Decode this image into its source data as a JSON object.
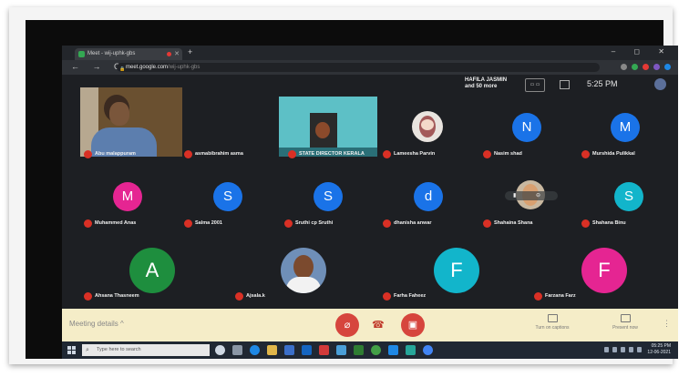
{
  "browser": {
    "tab_title": "Meet - wij-uphk-gbs",
    "new_tab": "+",
    "window_controls": "– ◻ ✕",
    "nav_buttons": "← → C",
    "url_host": "meet.google.com",
    "url_path": "/wij-uphk-gbs"
  },
  "meet_header": {
    "participants_line1": "HAFILA JASMIN",
    "participants_line2": "and 50 more",
    "time": "5:25 PM"
  },
  "tiles": [
    {
      "kind": "video",
      "name": "Abu malappuram"
    },
    {
      "kind": "dark",
      "name": "asmabibrahim asma"
    },
    {
      "kind": "video",
      "name": "STATE DIRECTOR KERALA"
    },
    {
      "kind": "photo",
      "name": "Lameesha Parvin"
    },
    {
      "kind": "letter",
      "letter": "N",
      "color": "#1a73e8",
      "name": "Nasim shad"
    },
    {
      "kind": "letter",
      "letter": "M",
      "color": "#1a73e8",
      "name": "Murshida Pulikkal"
    },
    {
      "kind": "letter",
      "letter": "M",
      "color": "#e52592",
      "name": "Muhammed Anas"
    },
    {
      "kind": "letter",
      "letter": "S",
      "color": "#1a73e8",
      "name": "Salma 2001"
    },
    {
      "kind": "letter",
      "letter": "S",
      "color": "#1a73e8",
      "name": "Sruthi cp Sruthi"
    },
    {
      "kind": "letter",
      "letter": "d",
      "color": "#1a73e8",
      "name": "dhanisha anwar"
    },
    {
      "kind": "photo",
      "name": "Shahaina Shana"
    },
    {
      "kind": "letter",
      "letter": "S",
      "color": "#12b5cb",
      "name": "Shahana Binu"
    },
    {
      "kind": "letter",
      "letter": "A",
      "color": "#1e8e3e",
      "name": "Ahsana Thasneem"
    },
    {
      "kind": "photo",
      "name": "Ajsala.k"
    },
    {
      "kind": "letter",
      "letter": "F",
      "color": "#12b5cb",
      "name": "Farha Faheez"
    },
    {
      "kind": "letter",
      "letter": "F",
      "color": "#e52592",
      "name": "Farzana Farz"
    }
  ],
  "controls": {
    "meeting_details": "Meeting details  ^",
    "captions_label": "Turn on captions",
    "present_label": "Present now",
    "kebab": "⋮"
  },
  "taskbar": {
    "search_placeholder": "Type here to search",
    "clock_time": "05:25 PM",
    "clock_date": "12-06-2021"
  },
  "colors": {
    "mic_off": "#d93025",
    "control_bar": "#f5edc8",
    "accent_blue": "#1a73e8"
  }
}
